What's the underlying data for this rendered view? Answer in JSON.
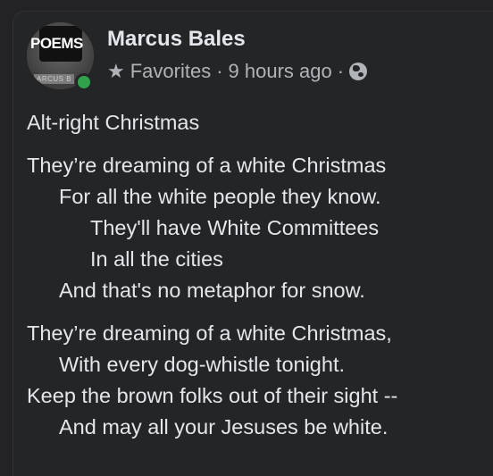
{
  "post": {
    "author": "Marcus Bales",
    "group": "Favorites",
    "separator": "·",
    "time": "9 hours ago",
    "avatar_title": "POEMS",
    "avatar_sub": "ARCUS B",
    "icons": {
      "star": "star-icon",
      "globe": "globe-icon",
      "online": "online-dot-icon"
    },
    "title": "Alt-right Christmas",
    "stanza1": [
      "They’re dreaming of a white Christmas",
      "For all the white people they know.",
      "They'll have White Committees",
      "In all the cities",
      "And that's no metaphor for snow."
    ],
    "stanza2": [
      "They’re dreaming of a white Christmas,",
      "With every dog-whistle tonight.",
      "Keep the brown folks out of their sight --",
      "And may all your Jesuses be white."
    ]
  },
  "colors": {
    "background": "#242526",
    "text": "#e4e6eb",
    "meta": "#b0b3b8",
    "online": "#31a24c"
  }
}
